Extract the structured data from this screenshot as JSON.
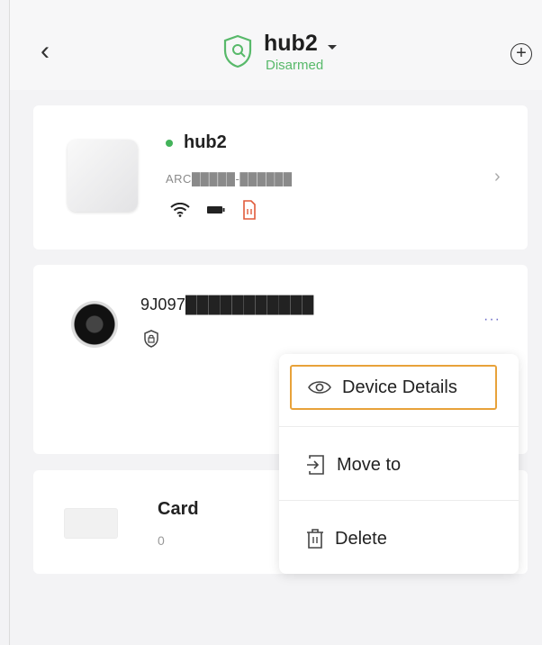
{
  "header": {
    "back_icon": "chevron-left-icon",
    "title": "hub2",
    "subtitle": "Disarmed",
    "subtitle_color": "#58b96a",
    "status_icon": "shield-check-icon",
    "add_icon": "plus-circle-icon"
  },
  "hub": {
    "name": "hub2",
    "status_color": "#43b35a",
    "serial": "ARC█████-██████",
    "icons": [
      "wifi-icon",
      "battery-icon",
      "sim-card-icon"
    ]
  },
  "camera": {
    "name": "9J097███████████",
    "more_label": "···"
  },
  "card": {
    "name": "Card",
    "count": "0"
  },
  "menu": {
    "items": [
      {
        "label": "Device Details",
        "icon": "eye-icon"
      },
      {
        "label": "Move to",
        "icon": "move-to-icon"
      },
      {
        "label": "Delete",
        "icon": "trash-icon"
      }
    ],
    "highlight_color": "#e8a23a"
  }
}
